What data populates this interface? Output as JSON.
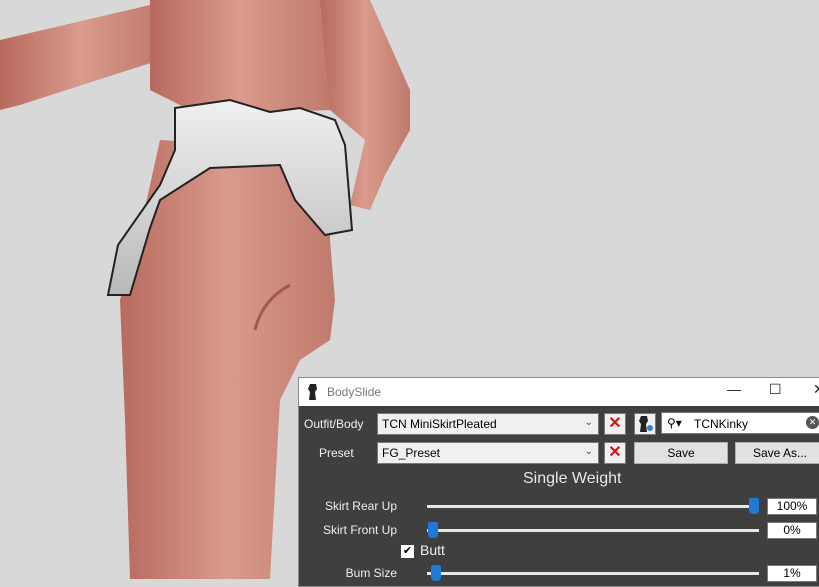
{
  "window": {
    "title": "BodySlide",
    "minimize_label": "—",
    "maximize_label": "☐",
    "close_label": "✕"
  },
  "outfit": {
    "label": "Outfit/Body",
    "value": "TCN MiniSkirtPleated"
  },
  "preset": {
    "label": "Preset",
    "value": "FG_Preset",
    "save_label": "Save",
    "save_as_label": "Save As..."
  },
  "group_filter": {
    "value": "TCNKinky"
  },
  "section": {
    "title": "Single Weight"
  },
  "sliders": [
    {
      "label": "Skirt Rear Up",
      "value_text": "100%",
      "value": 1.0
    },
    {
      "label": "Skirt Front Up",
      "value_text": "0%",
      "value": 0.0
    }
  ],
  "category": {
    "label": "Butt",
    "checked": true
  },
  "category_sliders": [
    {
      "label": "Bum Size",
      "value_text": "1%",
      "value": 0.01
    }
  ],
  "colors": {
    "panel": "#3f3f3f",
    "accent": "#1f7ad6",
    "clear_red": "#d01515"
  }
}
